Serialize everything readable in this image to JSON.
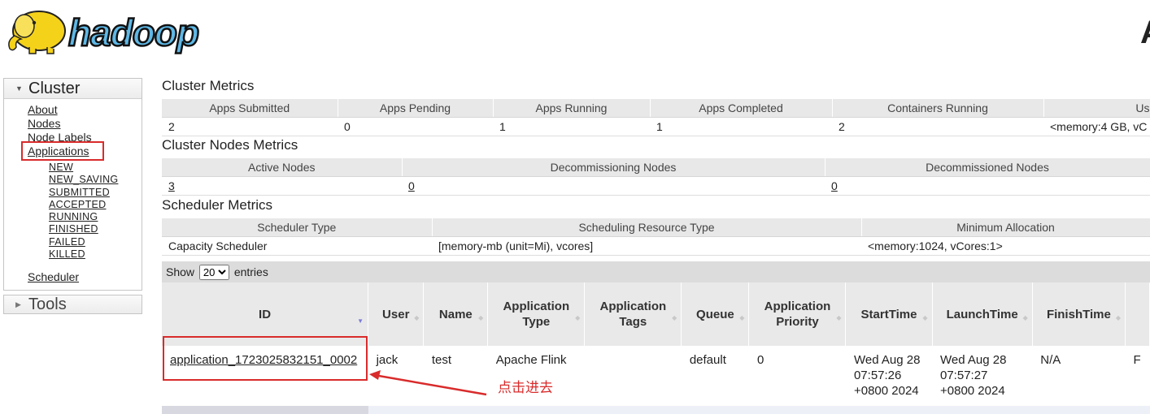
{
  "header": {
    "brand": "hadoop",
    "right_title": "A"
  },
  "sidebar": {
    "cluster_label": "Cluster",
    "links": [
      "About",
      "Nodes",
      "Node Labels",
      "Applications"
    ],
    "app_states": [
      "NEW",
      "NEW_SAVING",
      "SUBMITTED",
      "ACCEPTED",
      "RUNNING",
      "FINISHED",
      "FAILED",
      "KILLED"
    ],
    "scheduler_label": "Scheduler",
    "tools_label": "Tools"
  },
  "cluster_metrics": {
    "title": "Cluster Metrics",
    "headers": [
      "Apps Submitted",
      "Apps Pending",
      "Apps Running",
      "Apps Completed",
      "Containers Running",
      "Us"
    ],
    "values": [
      "2",
      "0",
      "1",
      "1",
      "2",
      "<memory:4 GB, vC"
    ]
  },
  "node_metrics": {
    "title": "Cluster Nodes Metrics",
    "headers": [
      "Active Nodes",
      "Decommissioning Nodes",
      "Decommissioned Nodes"
    ],
    "values": [
      "3",
      "0",
      "0"
    ]
  },
  "scheduler_metrics": {
    "title": "Scheduler Metrics",
    "headers": [
      "Scheduler Type",
      "Scheduling Resource Type",
      "Minimum Allocation"
    ],
    "values": [
      "Capacity Scheduler",
      "[memory-mb (unit=Mi), vcores]",
      "<memory:1024, vCores:1>"
    ]
  },
  "apps": {
    "show_label": "Show",
    "entries_label": "entries",
    "page_size": "20",
    "columns": [
      "ID",
      "User",
      "Name",
      "Application Type",
      "Application Tags",
      "Queue",
      "Application Priority",
      "StartTime",
      "LaunchTime",
      "FinishTime"
    ],
    "row": {
      "id": "application_1723025832151_0002",
      "user": "jack",
      "name": "test",
      "type": "Apache Flink",
      "tags": "",
      "queue": "default",
      "priority": "0",
      "start": [
        "Wed Aug 28",
        "07:57:26",
        "+0800 2024"
      ],
      "launch": [
        "Wed Aug 28",
        "07:57:27",
        "+0800 2024"
      ],
      "finish": "N/A",
      "trailing": "F"
    }
  },
  "annotation": {
    "text": "点击进去",
    "color": "#d92b2b"
  }
}
